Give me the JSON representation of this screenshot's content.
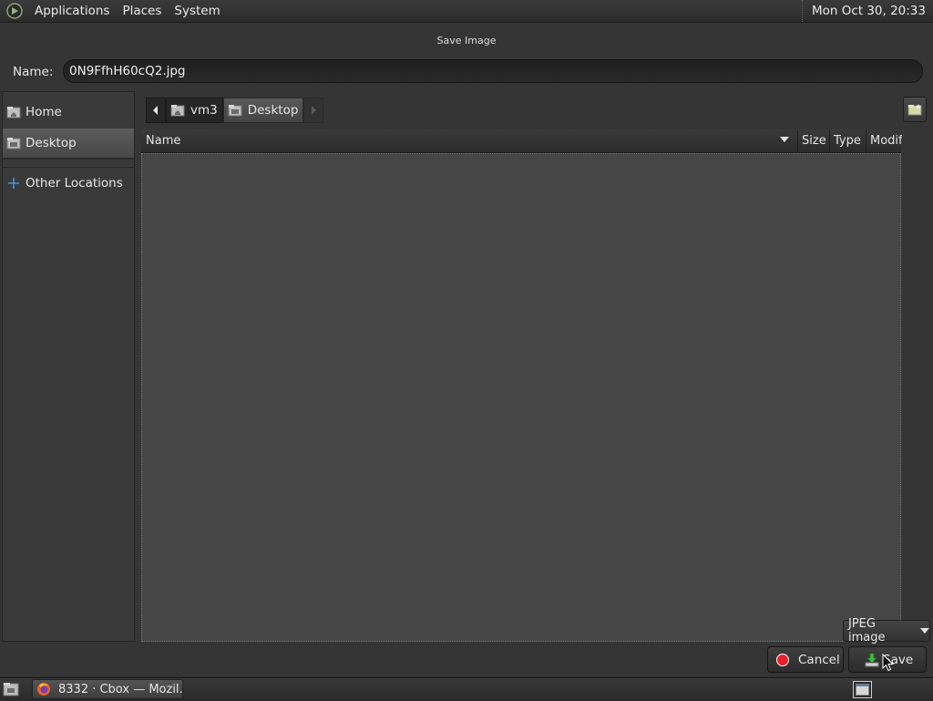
{
  "top_panel": {
    "menus": [
      "Applications",
      "Places",
      "System"
    ],
    "clock": "Mon Oct 30, 20:33",
    "logo_icon": "distro-logo-icon"
  },
  "dialog": {
    "title": "Save Image",
    "name_label": "Name:",
    "name_value": "0N9FfhH60cQ2.jpg",
    "sidebar": {
      "items": [
        {
          "label": "Home",
          "icon": "home-folder-icon",
          "selected": false
        },
        {
          "label": "Desktop",
          "icon": "desktop-folder-icon",
          "selected": true
        },
        {
          "label": "Other Locations",
          "icon": "plus-icon",
          "selected": false
        }
      ]
    },
    "pathbar": {
      "segments": [
        {
          "label": "vm3",
          "icon": "home-folder-icon",
          "active": false
        },
        {
          "label": "Desktop",
          "icon": "desktop-folder-icon",
          "active": true
        }
      ]
    },
    "file_list": {
      "columns": {
        "name": "Name",
        "size": "Size",
        "type": "Type",
        "modified": "Modified"
      },
      "rows": []
    },
    "file_type": "JPEG image",
    "cancel_label": "Cancel",
    "save_label": "Save"
  },
  "bottom_panel": {
    "task_label": "8332 · Cbox — Mozil…"
  },
  "colors": {
    "panel_bg": "#2f2f2f",
    "list_bg": "#464646",
    "cancel_red": "#e8202a",
    "save_green": "#3bbf3b"
  }
}
